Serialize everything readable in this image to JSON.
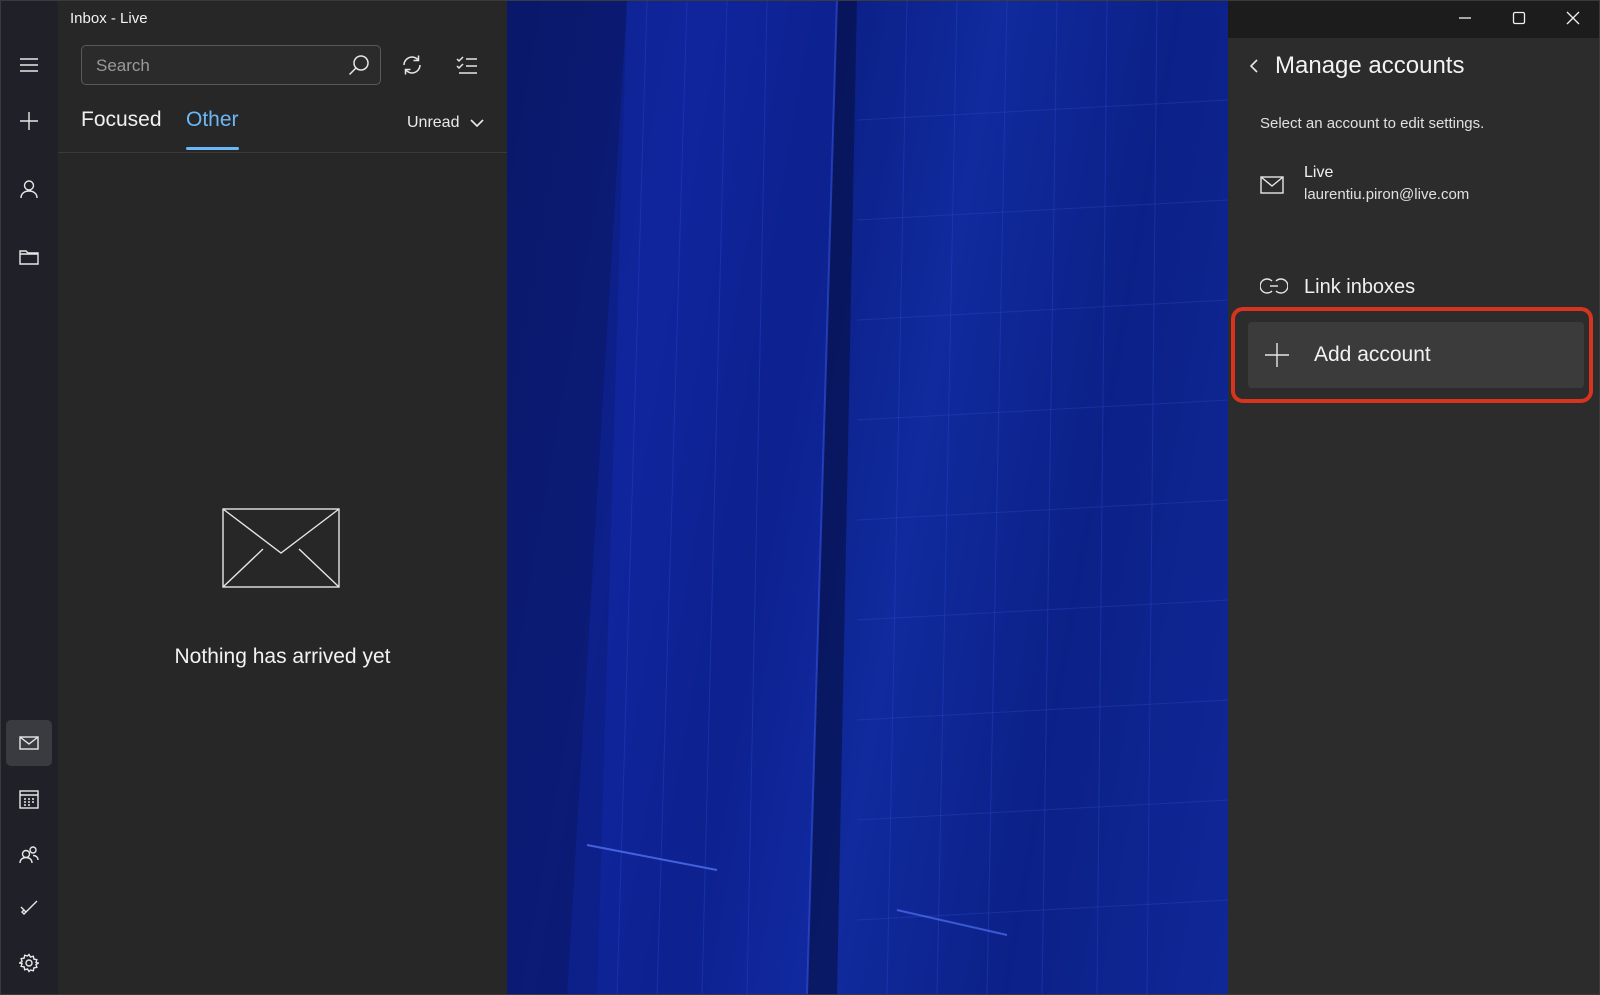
{
  "window": {
    "title": "Inbox - Live",
    "controls": [
      "minimize-icon",
      "maximize-icon",
      "close-icon"
    ]
  },
  "rail": {
    "top_items": [
      "menu-icon",
      "new-mail-icon",
      "account-icon",
      "folder-icon"
    ],
    "bottom_items": [
      "mail-icon",
      "calendar-icon",
      "people-icon",
      "todo-icon",
      "settings-icon"
    ],
    "active_item": "mail-icon"
  },
  "list": {
    "search_placeholder": "Search",
    "tabs": [
      {
        "label": "Focused",
        "selected": false
      },
      {
        "label": "Other",
        "selected": true
      }
    ],
    "filter_label": "Unread",
    "empty_message": "Nothing has arrived yet"
  },
  "panel": {
    "title": "Manage accounts",
    "subtitle": "Select an account to edit settings.",
    "account": {
      "name": "Live",
      "email": "laurentiu.piron@live.com"
    },
    "link_inboxes_label": "Link inboxes",
    "add_account_label": "Add account"
  },
  "colors": {
    "accent": "#6cb8f6",
    "highlight": "#d7341f",
    "panel_bg": "#2c2c2c",
    "list_bg": "#272727",
    "rail_bg": "#1f2028"
  }
}
